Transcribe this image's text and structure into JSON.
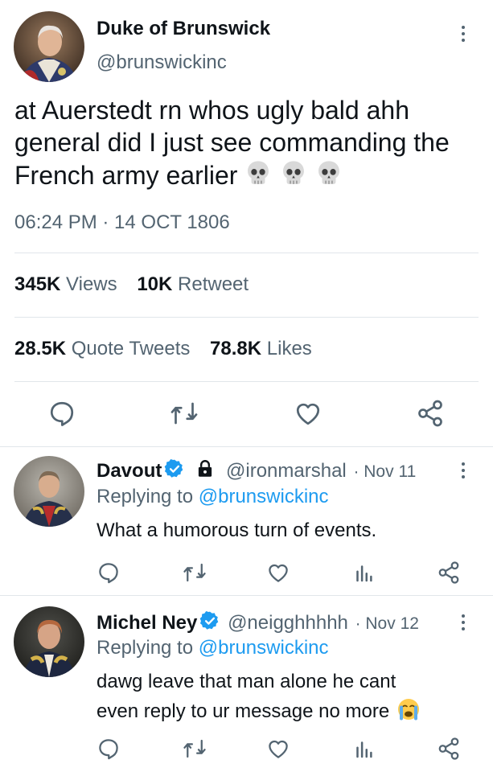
{
  "main_tweet": {
    "author_name": "Duke of Brunswick",
    "author_handle": "@brunswickinc",
    "text": "at Auerstedt rn whos ugly bald ahh general did I just see commanding the French army earlier",
    "emoji_suffix": [
      "skull",
      "skull",
      "skull"
    ],
    "timestamp": "06:24 PM · 14 OCT 1806",
    "stats": {
      "views_count": "345K",
      "views_label": "Views",
      "retweets_count": "10K",
      "retweets_label": "Retweet",
      "quotes_count": "28.5K",
      "quotes_label": "Quote Tweets",
      "likes_count": "78.8K",
      "likes_label": "Likes"
    },
    "actions": [
      "reply-icon",
      "retweet-icon",
      "like-icon",
      "share-icon"
    ]
  },
  "replies": [
    {
      "author_name": "Davout",
      "verified": true,
      "protected": true,
      "author_handle": "@ironmarshal",
      "date": "· Nov 11",
      "replying_label": "Replying to",
      "replying_handle": "@brunswickinc",
      "text": "What a humorous turn of events.",
      "actions": [
        "reply-icon",
        "retweet-icon",
        "like-icon",
        "analytics-icon",
        "share-icon"
      ]
    },
    {
      "author_name": "Michel Ney",
      "verified": true,
      "protected": false,
      "author_handle": "@neigghhhhh",
      "date": "· Nov 12",
      "replying_label": "Replying to",
      "replying_handle": "@brunswickinc",
      "text_line1": "dawg leave that man alone he cant",
      "text_line2": "even reply to ur message no more",
      "emoji": "crying-face",
      "actions": [
        "reply-icon",
        "retweet-icon",
        "like-icon",
        "analytics-icon",
        "share-icon"
      ]
    }
  ],
  "colors": {
    "accent": "#1d9bf0",
    "muted": "#536471",
    "divider": "#e1e6ea",
    "text": "#0f1419"
  }
}
